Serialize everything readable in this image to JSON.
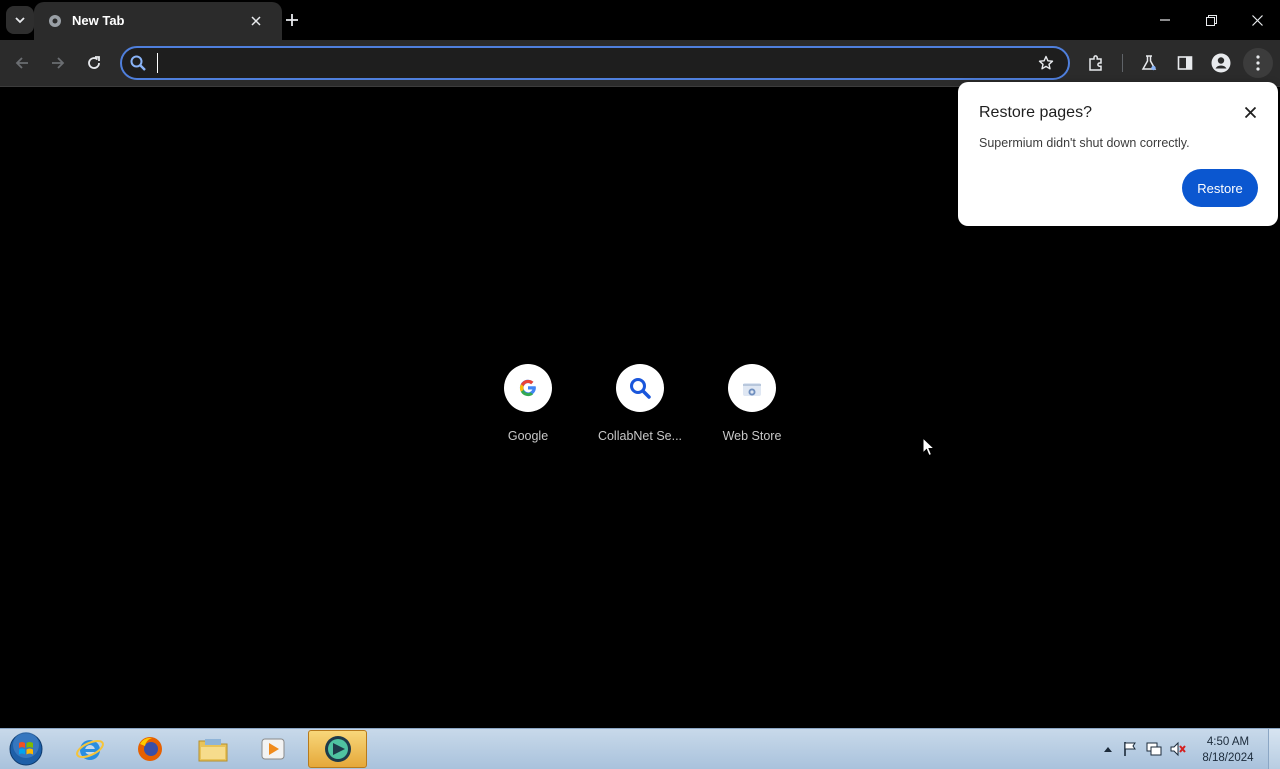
{
  "browser": {
    "tab": {
      "title": "New Tab"
    },
    "omnibox": {
      "value": "",
      "placeholder": ""
    }
  },
  "popup": {
    "title": "Restore pages?",
    "message": "Supermium didn't shut down correctly.",
    "restore_label": "Restore"
  },
  "shortcuts": [
    {
      "label": "Google",
      "icon": "google-icon"
    },
    {
      "label": "CollabNet Se...",
      "icon": "search-icon"
    },
    {
      "label": "Web Store",
      "icon": "web-store-icon"
    }
  ],
  "taskbar": {
    "apps": [
      "internet-explorer-icon",
      "firefox-icon",
      "file-explorer-icon",
      "media-player-icon",
      "supermium-icon"
    ],
    "clock": {
      "time": "4:50 AM",
      "date": "8/18/2024"
    }
  },
  "colors": {
    "accent": "#0b57d0",
    "omnibox_border": "#4f7fdc",
    "toolbar_bg": "#2b2b2b",
    "page_bg": "#000000"
  }
}
